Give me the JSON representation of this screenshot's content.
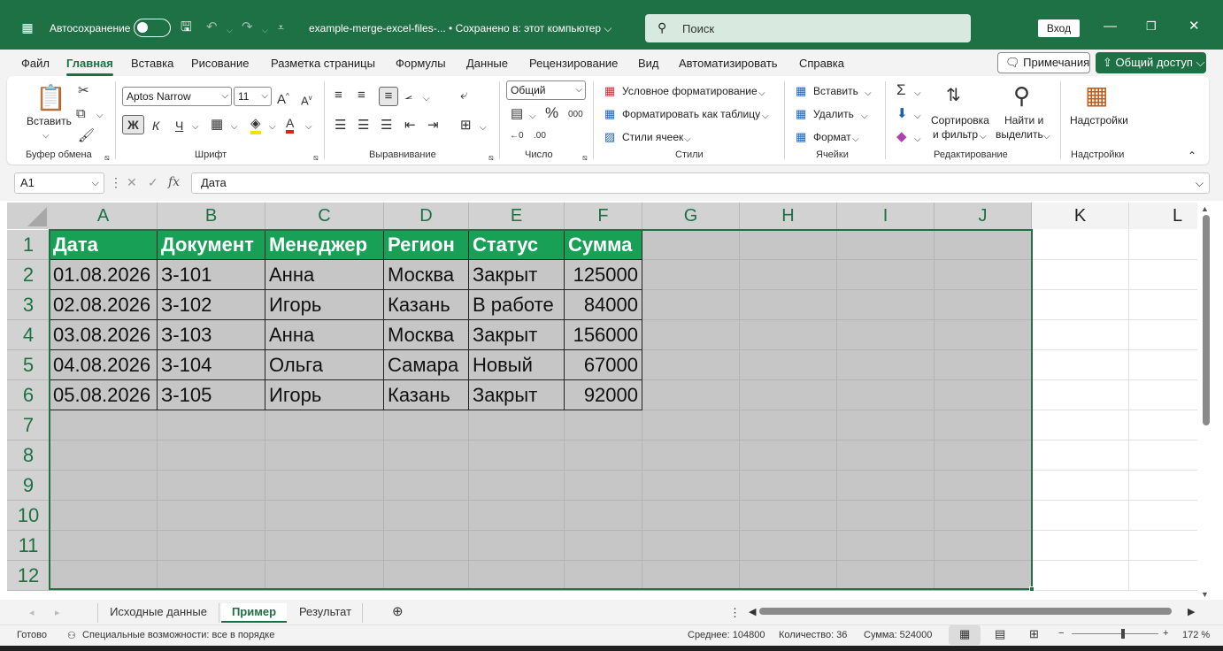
{
  "title_bar": {
    "autosave_label": "Автосохранение",
    "doc_title": "example-merge-excel-files-... • Сохранено в: этот компьютер ⌵",
    "search_placeholder": "Поиск",
    "signin_label": "Вход"
  },
  "menu": {
    "tabs": [
      "Файл",
      "Главная",
      "Вставка",
      "Рисование",
      "Разметка страницы",
      "Формулы",
      "Данные",
      "Рецензирование",
      "Вид",
      "Автоматизировать",
      "Справка"
    ],
    "active_tab": "Главная",
    "notes_label": "Примечания",
    "share_label": "Общий доступ"
  },
  "ribbon": {
    "clipboard": {
      "paste_label": "Вставить",
      "group_label": "Буфер обмена"
    },
    "font": {
      "font_name": "Aptos Narrow",
      "font_size": "11",
      "bold": "Ж",
      "italic": "К",
      "underline": "Ч",
      "group_label": "Шрифт"
    },
    "alignment": {
      "group_label": "Выравнивание"
    },
    "number": {
      "format": "Общий",
      "group_label": "Число"
    },
    "styles": {
      "conditional": "Условное форматирование",
      "as_table": "Форматировать как таблицу",
      "cell_styles": "Стили ячеек",
      "group_label": "Стили"
    },
    "cells": {
      "insert": "Вставить",
      "delete": "Удалить",
      "format": "Формат",
      "group_label": "Ячейки"
    },
    "editing": {
      "sort_line1": "Сортировка",
      "sort_line2": "и фильтр",
      "find_line1": "Найти и",
      "find_line2": "выделить",
      "group_label": "Редактирование"
    },
    "addins": {
      "label": "Надстройки",
      "group_label": "Надстройки"
    }
  },
  "formula_bar": {
    "name_box": "A1",
    "fx": "fx",
    "content": "Дата"
  },
  "grid": {
    "columns": [
      "A",
      "B",
      "C",
      "D",
      "E",
      "F",
      "G",
      "H",
      "I",
      "J",
      "K",
      "L"
    ],
    "rows": [
      "1",
      "2",
      "3",
      "4",
      "5",
      "6",
      "7",
      "8",
      "9",
      "10",
      "11",
      "12"
    ],
    "table": [
      [
        "Дата",
        "Документ",
        "Менеджер",
        "Регион",
        "Статус",
        "Сумма"
      ],
      [
        "01.08.2026",
        "З-101",
        "Анна",
        "Москва",
        "Закрыт",
        "125000"
      ],
      [
        "02.08.2026",
        "З-102",
        "Игорь",
        "Казань",
        "В работе",
        "84000"
      ],
      [
        "03.08.2026",
        "З-103",
        "Анна",
        "Москва",
        "Закрыт",
        "156000"
      ],
      [
        "04.08.2026",
        "З-104",
        "Ольга",
        "Самара",
        "Новый",
        "67000"
      ],
      [
        "05.08.2026",
        "З-105",
        "Игорь",
        "Казань",
        "Закрыт",
        "92000"
      ]
    ]
  },
  "sheets": {
    "tabs": [
      "Исходные данные",
      "Пример",
      "Результат"
    ],
    "active": "Пример"
  },
  "status": {
    "ready": "Готово",
    "accessibility": "Специальные возможности: все в порядке",
    "average": "Среднее: 104800",
    "count": "Количество: 36",
    "sum": "Сумма: 524000",
    "zoom": "172 %"
  },
  "colors": {
    "accent": "#1e7045",
    "table_header": "#18a056",
    "selection": "#c6c6c6"
  }
}
